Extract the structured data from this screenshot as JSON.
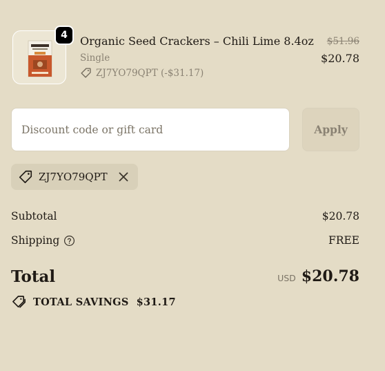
{
  "line_item": {
    "quantity": "4",
    "title": "Organic Seed Crackers – Chili Lime 8.4oz",
    "variant": "Single",
    "discount_code": "ZJ7YO79QPT (-$31.17)",
    "compare_at_price": "$51.96",
    "price": "$20.78",
    "image_icon": "cracker-box-thumbnail"
  },
  "discount": {
    "placeholder": "Discount code or gift card",
    "value": "",
    "apply_label": "Apply"
  },
  "applied_code": {
    "code": "ZJ7YO79QPT",
    "icon": "tag-icon",
    "remove_icon": "close-icon"
  },
  "totals": {
    "subtotal_label": "Subtotal",
    "subtotal_value": "$20.78",
    "shipping_label": "Shipping",
    "shipping_value": "FREE",
    "total_label": "Total",
    "currency": "USD",
    "total_value": "$20.78",
    "savings_label": "TOTAL SAVINGS",
    "savings_value": "$31.17"
  },
  "colors": {
    "background": "#e4dcc6",
    "chip": "#d8d0b9",
    "text": "#1f1a15",
    "muted": "#8a8273"
  }
}
